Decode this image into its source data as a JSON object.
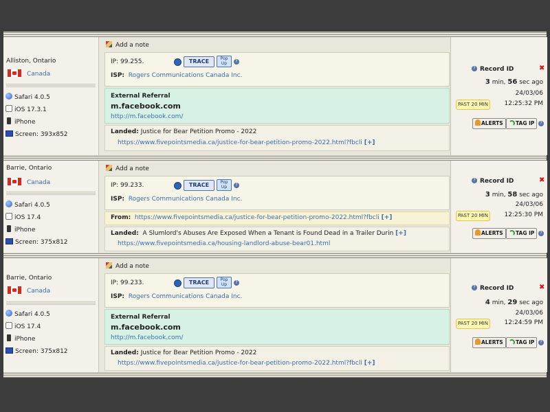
{
  "labels": {
    "add_note": "Add a note",
    "ip_label": "IP:",
    "isp_label": "ISP:",
    "external_referral": "External Referral",
    "from_label": "From:",
    "landed_label": "Landed:",
    "record_id": "Record ID",
    "past": "PAST 20 MIN",
    "alerts": "ALERTS",
    "tag_ip": "TAG IP",
    "trace": "TRACE",
    "popup": "Pop Up",
    "expand": "[+]"
  },
  "visits": [
    {
      "location": "Alliston, Ontario",
      "country": "Canada",
      "browser": "Safari 4.0.5",
      "os": "iOS 17.3.1",
      "device": "iPhone",
      "screen": "Screen: 393x852",
      "ip": "99.255.",
      "isp": "Rogers Communications Canada Inc.",
      "ref_domain": "m.facebook.com",
      "ref_url": "http://m.facebook.com/",
      "landed_title": "Justice for Bear Petition Promo - 2022",
      "landed_url": "https://www.fivepointsmedia.ca/justice-for-bear-petition-promo-2022.html?fbcli",
      "ago_min": "3",
      "ago_sec": "56",
      "ago_text_min": "min,",
      "ago_text_sec": "sec ago",
      "date": "24/03/06",
      "time": "12:25:32 PM"
    },
    {
      "location": "Barrie, Ontario",
      "country": "Canada",
      "browser": "Safari 4.0.5",
      "os": "iOS 17.4",
      "device": "iPhone",
      "screen": "Screen: 375x812",
      "ip": "99.233.",
      "isp": "Rogers Communications Canada Inc.",
      "from_url": "https://www.fivepointsmedia.ca/justice-for-bear-petition-promo-2022.html?fbcli",
      "landed_title": "A Slumlord's Abuses Are Exposed When a Tenant is Found Dead in a Trailer Durin",
      "landed_url": "https://www.fivepointsmedia.ca/housing-landlord-abuse-bear01.html",
      "ago_min": "3",
      "ago_sec": "58",
      "ago_text_min": "min,",
      "ago_text_sec": "sec ago",
      "date": "24/03/06",
      "time": "12:25:30 PM"
    },
    {
      "location": "Barrie, Ontario",
      "country": "Canada",
      "browser": "Safari 4.0.5",
      "os": "iOS 17.4",
      "device": "iPhone",
      "screen": "Screen: 375x812",
      "ip": "99.233.",
      "isp": "Rogers Communications Canada Inc.",
      "ref_domain": "m.facebook.com",
      "ref_url": "http://m.facebook.com/",
      "landed_title": "Justice for Bear Petition Promo - 2022",
      "landed_url": "https://www.fivepointsmedia.ca/justice-for-bear-petition-promo-2022.html?fbcli",
      "ago_min": "4",
      "ago_sec": "29",
      "ago_text_min": "min,",
      "ago_text_sec": "sec ago",
      "date": "24/03/06",
      "time": "12:24:59 PM"
    }
  ]
}
